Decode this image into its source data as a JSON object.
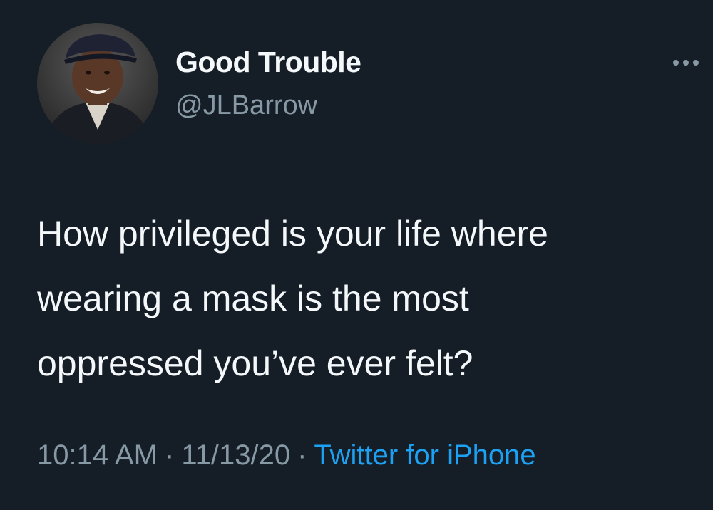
{
  "author": {
    "display_name": "Good Trouble",
    "handle": "@JLBarrow",
    "avatar_icon": "profile-photo"
  },
  "more_icon": "more-horizontal-icon",
  "tweet": {
    "lines": [
      "How privileged is your life where",
      "wearing a mask is the most",
      "oppressed you’ve ever felt?"
    ]
  },
  "meta": {
    "time": "10:14 AM",
    "separator": "·",
    "date": "11/13/20",
    "source": "Twitter for iPhone"
  },
  "colors": {
    "background": "#151d26",
    "primary_text": "#f5f8fa",
    "secondary_text": "#8899a6",
    "link": "#1da1f2"
  }
}
